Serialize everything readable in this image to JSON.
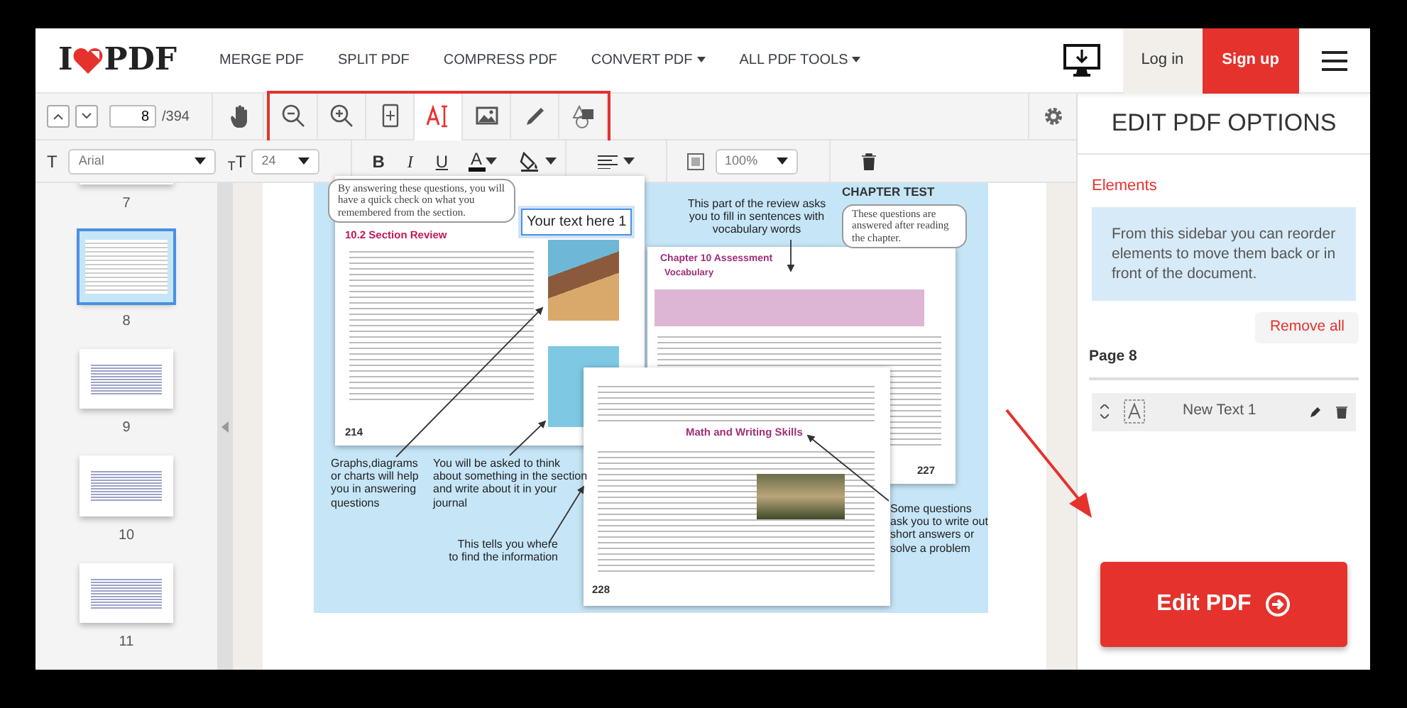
{
  "navbar": {
    "logo": {
      "before": "I",
      "after": "PDF"
    },
    "links": [
      {
        "label": "MERGE PDF",
        "dropdown": false
      },
      {
        "label": "SPLIT PDF",
        "dropdown": false
      },
      {
        "label": "COMPRESS PDF",
        "dropdown": false
      },
      {
        "label": "CONVERT PDF",
        "dropdown": true
      },
      {
        "label": "ALL PDF TOOLS",
        "dropdown": true
      }
    ],
    "login": "Log in",
    "signup": "Sign up"
  },
  "toolbar": {
    "page": "8",
    "total": "/394",
    "tool_groups": [
      {
        "highlighted": false,
        "tools": [
          {
            "kind": "hand",
            "selected": false
          }
        ]
      },
      {
        "highlighted": true,
        "tools": [
          {
            "kind": "zoom-out",
            "selected": false
          },
          {
            "kind": "zoom-in",
            "selected": false
          },
          {
            "kind": "fit",
            "selected": false
          },
          {
            "kind": "text",
            "selected": true
          },
          {
            "kind": "image",
            "selected": false
          },
          {
            "kind": "draw",
            "selected": false
          },
          {
            "kind": "shape",
            "selected": false
          }
        ]
      }
    ]
  },
  "format_bar": {
    "font_label": "T",
    "font": "Arial",
    "size_label": "$_{T}$T",
    "size": "24",
    "styles": [
      {
        "kind": "bold",
        "glyph": "B"
      },
      {
        "kind": "italic",
        "glyph": "I"
      },
      {
        "kind": "underline",
        "glyph": "U"
      },
      {
        "kind": "text-color",
        "glyph": "A"
      }
    ],
    "opacity": "100%"
  },
  "thumbnails": [
    {
      "label": "7",
      "kind": "contents",
      "selected": false
    },
    {
      "label": "8",
      "kind": "spread",
      "selected": true
    },
    {
      "label": "9",
      "kind": "contents",
      "selected": false
    },
    {
      "label": "10",
      "kind": "contents",
      "selected": false
    },
    {
      "label": "11",
      "kind": "contents",
      "selected": false
    }
  ],
  "document": {
    "callouts": [
      {
        "kind": "bubble",
        "text": "By answering these questions, you will have a quick check on what you remembered from the section."
      },
      {
        "kind": "note",
        "text": "This part of the review asks you to fill in sentences with vocabulary words"
      },
      {
        "kind": "bubble",
        "text": "These questions are answered after reading the chapter."
      },
      {
        "kind": "note",
        "text": "Graphs,diagrams or charts will help you in answering questions"
      },
      {
        "kind": "note",
        "text": "You will be asked to think about something in the section and write about it in your journal"
      },
      {
        "kind": "note",
        "text": "This tells you where to find the information"
      },
      {
        "kind": "note",
        "text": "Some questions ask you to write out short answers or solve a problem"
      }
    ],
    "chapter_test": "CHAPTER TEST",
    "textbox": "Your text here 1",
    "left_page": {
      "heading": "10.2 Section Review",
      "number": "214"
    },
    "right_page": {
      "heading": "Chapter 10 Assessment",
      "subheading": "Vocabulary",
      "number": "227"
    },
    "front_page": {
      "heading": "Math and Writing Skills",
      "number": "228"
    }
  },
  "sidebar": {
    "title": "EDIT PDF OPTIONS",
    "section": "Elements",
    "info": "From this sidebar you can reorder elements to move them back or in front of the document.",
    "remove_all": "Remove all",
    "page_label": "Page 8",
    "elements": [
      {
        "name": "New Text 1"
      }
    ],
    "submit": "Edit PDF"
  }
}
